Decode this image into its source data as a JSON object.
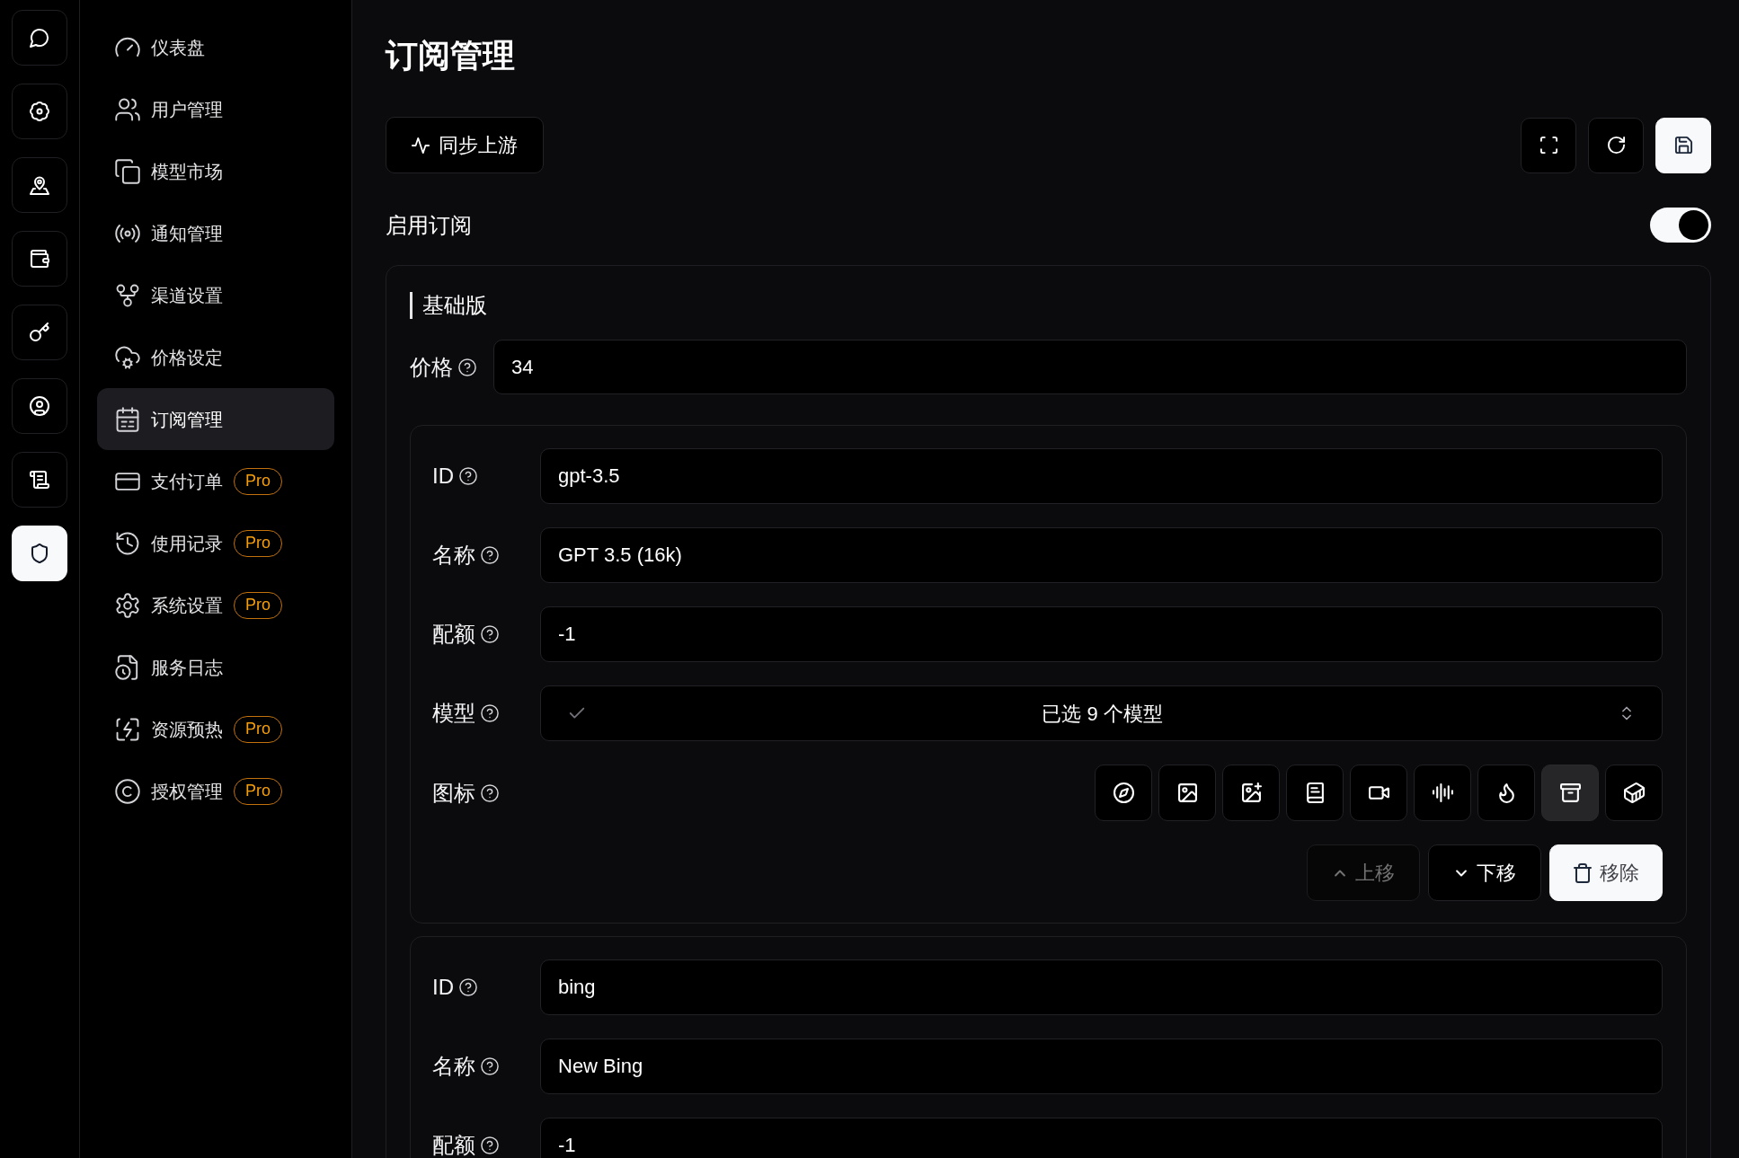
{
  "rail": [
    {
      "selected": false
    },
    {
      "selected": false
    },
    {
      "selected": false
    },
    {
      "selected": false
    },
    {
      "selected": false
    },
    {
      "selected": false
    },
    {
      "selected": false
    },
    {
      "selected": true
    }
  ],
  "sidebar": {
    "items": [
      {
        "label": "仪表盘",
        "selected": false
      },
      {
        "label": "用户管理",
        "selected": false
      },
      {
        "label": "模型市场",
        "selected": false
      },
      {
        "label": "通知管理",
        "selected": false
      },
      {
        "label": "渠道设置",
        "selected": false
      },
      {
        "label": "价格设定",
        "selected": false
      },
      {
        "label": "订阅管理",
        "selected": true
      },
      {
        "label": "支付订单",
        "selected": false,
        "badge": "Pro"
      },
      {
        "label": "使用记录",
        "selected": false,
        "badge": "Pro"
      },
      {
        "label": "系统设置",
        "selected": false,
        "badge": "Pro"
      },
      {
        "label": "服务日志",
        "selected": false
      },
      {
        "label": "资源预热",
        "selected": false,
        "badge": "Pro"
      },
      {
        "label": "授权管理",
        "selected": false,
        "badge": "Pro"
      }
    ]
  },
  "header": {
    "title": "订阅管理",
    "sync_button": {
      "label": "同步上游"
    },
    "toolbar": [
      {
        "primary": false
      },
      {
        "primary": false
      },
      {
        "primary": true
      }
    ]
  },
  "subscription": {
    "label": "启用订阅",
    "on": true
  },
  "plan": {
    "title": "基础版",
    "price": {
      "label": "价格",
      "value": "34"
    },
    "models": [
      {
        "fields": [
          {
            "kind": "text",
            "label": "ID",
            "value": "gpt-3.5"
          },
          {
            "kind": "text",
            "label": "名称",
            "value": "GPT 3.5 (16k)"
          },
          {
            "kind": "text",
            "label": "配额",
            "value": "-1"
          },
          {
            "kind": "select",
            "label": "模型",
            "value": "已选 9 个模型"
          },
          {
            "kind": "icons",
            "label": "图标",
            "options": [
              {
                "selected": false
              },
              {
                "selected": false
              },
              {
                "selected": false
              },
              {
                "selected": false
              },
              {
                "selected": false
              },
              {
                "selected": false
              },
              {
                "selected": false
              },
              {
                "selected": true
              },
              {
                "selected": false
              }
            ]
          }
        ],
        "actions": [
          {
            "kind": "up",
            "label": "上移",
            "disabled": true
          },
          {
            "kind": "down",
            "label": "下移",
            "disabled": false
          },
          {
            "kind": "remove",
            "label": "移除",
            "disabled": false
          }
        ]
      },
      {
        "fields": [
          {
            "kind": "text",
            "label": "ID",
            "value": "bing"
          },
          {
            "kind": "text",
            "label": "名称",
            "value": "New Bing"
          },
          {
            "kind": "text",
            "label": "配额",
            "value": "-1"
          }
        ]
      }
    ]
  }
}
